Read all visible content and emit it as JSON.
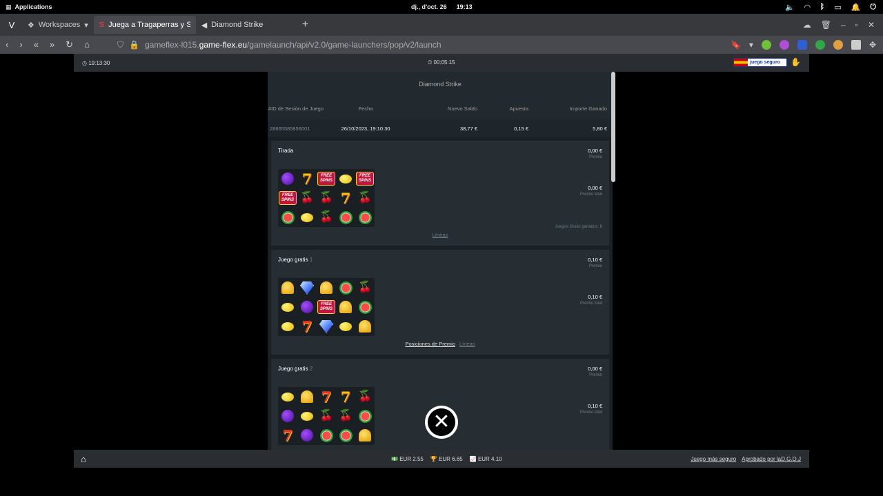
{
  "os": {
    "apps_label": "Applications",
    "date": "dj., d'oct. 26",
    "time": "19:13"
  },
  "browser": {
    "workspaces_label": "Workspaces",
    "tabs": [
      {
        "title": "Juega a Tragaperras y Sl...",
        "active": true
      },
      {
        "title": "Diamond Strike",
        "active": false
      }
    ],
    "url_prefix": "gameflex-l015.",
    "url_domain": "game-flex.eu",
    "url_path": "/gamelaunch/api/v2.0/game-launchers/pop/v2/launch"
  },
  "game_header": {
    "clock": "19:13:30",
    "elapsed": "00:05:15",
    "badge": "juego seguro"
  },
  "history": {
    "title": "Diamond Strike",
    "columns": [
      "#ID de Sesión de Juego",
      "Fecha",
      "Nuevo Saldo",
      "Apuesta",
      "Importe Ganado"
    ],
    "row": {
      "id": "28665585856001",
      "date": "26/10/2023, 19:10:30",
      "balance": "38,77 €",
      "bet": "0,15 €",
      "won": "5,80 €"
    }
  },
  "sections": [
    {
      "name": "Tirada",
      "num": "",
      "prize": "0,00 €",
      "prize_label": "Premio",
      "total": "0,00 €",
      "total_label": "Premio total",
      "free_games": "Juegos Gratis ganados: 6",
      "link_primary": "",
      "link_lines": "Líneas",
      "grid": [
        [
          "plum",
          "seven-gold",
          "free",
          "lemon",
          "free"
        ],
        [
          "free",
          "cherry",
          "cherry",
          "seven-gold",
          "cherry"
        ],
        [
          "melon",
          "lemon",
          "cherry",
          "melon",
          "melon"
        ]
      ]
    },
    {
      "name": "Juego gratis",
      "num": "1",
      "prize": "0,10 €",
      "prize_label": "Premio",
      "total": "0,10 €",
      "total_label": "Premio total",
      "free_games": "",
      "link_primary": "Posiciones de Premio",
      "link_lines": "Líneas",
      "grid": [
        [
          "bell",
          "diamond",
          "bell",
          "melon",
          "cherry"
        ],
        [
          "lemon",
          "plum",
          "free",
          "bell",
          "melon"
        ],
        [
          "lemon",
          "seven",
          "diamond",
          "lemon",
          "bell"
        ]
      ]
    },
    {
      "name": "Juego gratis",
      "num": "2",
      "prize": "0,00 €",
      "prize_label": "Premio",
      "total": "0,10 €",
      "total_label": "Premio total",
      "free_games": "",
      "link_primary": "",
      "link_lines": "",
      "grid": [
        [
          "lemon",
          "bell",
          "seven",
          "seven-gold",
          "cherry"
        ],
        [
          "plum",
          "lemon",
          "cherry",
          "cherry",
          "melon"
        ],
        [
          "seven",
          "plum",
          "melon",
          "melon",
          "bell"
        ]
      ]
    }
  ],
  "footer": {
    "balance": "EUR 2.55",
    "won": "EUR 6.65",
    "net": "EUR 4.10",
    "link1": "Juego más seguro",
    "link2": "Aprobado por laD.G.O.J"
  },
  "icons": {
    "free_text_1": "FREE",
    "free_text_2": "SPINS"
  }
}
